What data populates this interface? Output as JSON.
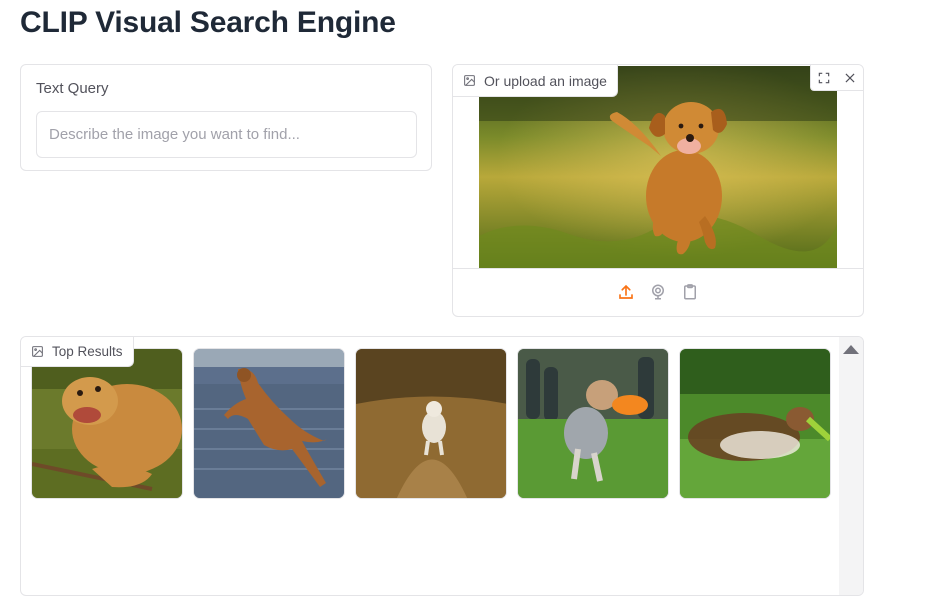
{
  "header": {
    "title": "CLIP Visual Search Engine"
  },
  "query": {
    "label": "Text Query",
    "placeholder": "Describe the image you want to find...",
    "value": ""
  },
  "upload": {
    "label": "Or upload an image",
    "icon": "image-icon",
    "top_actions": [
      "fullscreen-icon",
      "close-icon"
    ],
    "sources": [
      {
        "name": "upload-icon",
        "color": "#f97316"
      },
      {
        "name": "webcam-icon",
        "color": "#a1a1aa"
      },
      {
        "name": "clipboard-icon",
        "color": "#a1a1aa"
      }
    ],
    "preview": "golden retriever running in grass"
  },
  "results": {
    "label": "Top Results",
    "icon": "image-icon",
    "items": [
      {
        "subject": "golden retriever lying with a stick"
      },
      {
        "subject": "brown dog jumping on beach"
      },
      {
        "subject": "white dog running on dirt path"
      },
      {
        "subject": "australian shepherd catching orange frisbee"
      },
      {
        "subject": "sheltie running with green toy"
      }
    ]
  },
  "theme": {
    "accent": "#f97316",
    "border": "#e4e4e7",
    "muted_text": "#52525b"
  }
}
